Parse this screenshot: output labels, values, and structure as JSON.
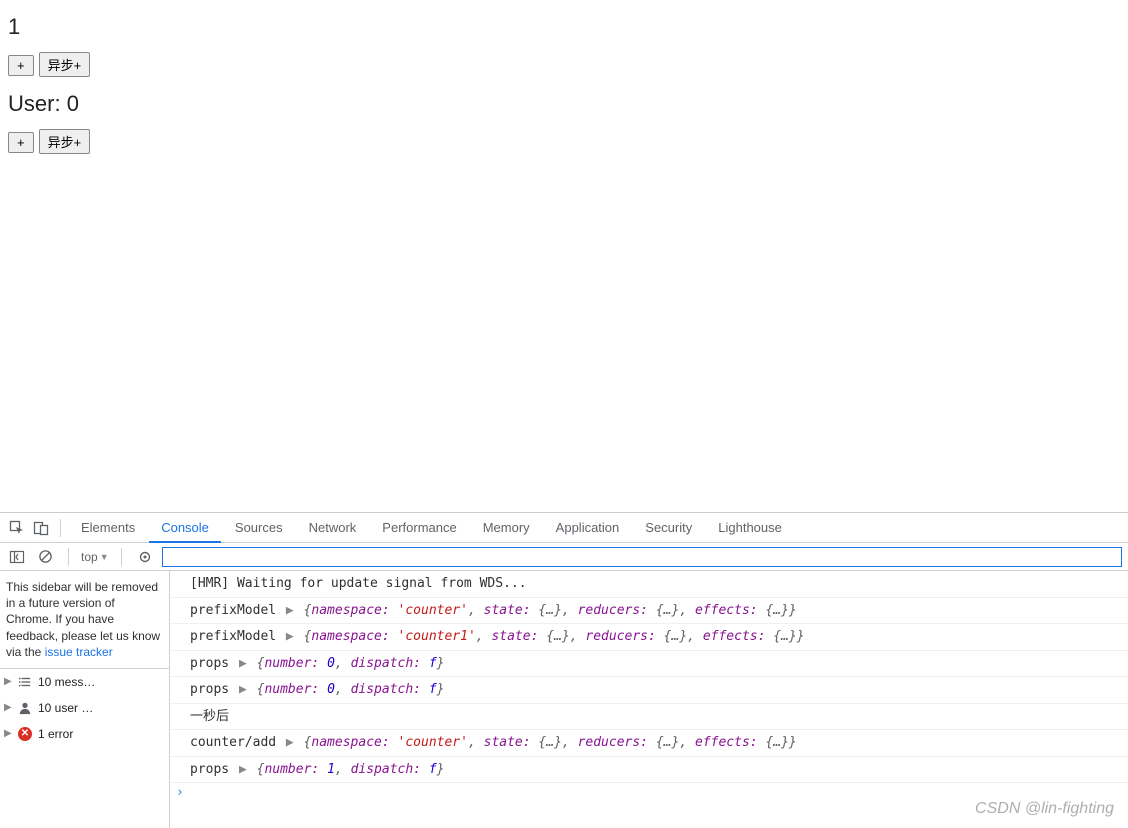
{
  "app": {
    "counter_value": "1",
    "plus_label": "+",
    "async_label": "异步+",
    "user_label_prefix": "User: ",
    "user_value": "0"
  },
  "devtools": {
    "tabs": [
      "Elements",
      "Console",
      "Sources",
      "Network",
      "Performance",
      "Memory",
      "Application",
      "Security",
      "Lighthouse"
    ],
    "active_tab": "Console",
    "context_label": "top",
    "filter_placeholder": "",
    "sidebar_notice_1": "This sidebar will be removed in a future version of Chrome. If you have feedback, please let us know via the ",
    "sidebar_notice_link": "issue tracker",
    "stats": [
      {
        "icon": "list",
        "label": "10 mess…"
      },
      {
        "icon": "user",
        "label": "10 user …"
      },
      {
        "icon": "error",
        "label": "1 error"
      }
    ]
  },
  "console_lines": [
    {
      "type": "plain",
      "text": "[HMR] Waiting for update signal from WDS..."
    },
    {
      "type": "obj",
      "label": "prefixModel",
      "segments": [
        {
          "k": "namespace:",
          "v": "'counter'",
          "cls": "str"
        },
        {
          "k": "state:",
          "v": "{…}",
          "cls": "obj"
        },
        {
          "k": "reducers:",
          "v": "{…}",
          "cls": "obj"
        },
        {
          "k": "effects:",
          "v": "{…}",
          "cls": "obj"
        }
      ]
    },
    {
      "type": "obj",
      "label": "prefixModel",
      "segments": [
        {
          "k": "namespace:",
          "v": "'counter1'",
          "cls": "str"
        },
        {
          "k": "state:",
          "v": "{…}",
          "cls": "obj"
        },
        {
          "k": "reducers:",
          "v": "{…}",
          "cls": "obj"
        },
        {
          "k": "effects:",
          "v": "{…}",
          "cls": "obj"
        }
      ]
    },
    {
      "type": "obj",
      "label": "props",
      "segments": [
        {
          "k": "number:",
          "v": "0",
          "cls": "num"
        },
        {
          "k": "dispatch:",
          "v": "f",
          "cls": "fn"
        }
      ]
    },
    {
      "type": "obj",
      "label": "props",
      "segments": [
        {
          "k": "number:",
          "v": "0",
          "cls": "num"
        },
        {
          "k": "dispatch:",
          "v": "f",
          "cls": "fn"
        }
      ]
    },
    {
      "type": "plain",
      "text": "一秒后"
    },
    {
      "type": "obj",
      "label": "counter/add",
      "segments": [
        {
          "k": "namespace:",
          "v": "'counter'",
          "cls": "str"
        },
        {
          "k": "state:",
          "v": "{…}",
          "cls": "obj"
        },
        {
          "k": "reducers:",
          "v": "{…}",
          "cls": "obj"
        },
        {
          "k": "effects:",
          "v": "{…}",
          "cls": "obj"
        }
      ]
    },
    {
      "type": "obj",
      "label": "props",
      "segments": [
        {
          "k": "number:",
          "v": "1",
          "cls": "num"
        },
        {
          "k": "dispatch:",
          "v": "f",
          "cls": "fn"
        }
      ]
    }
  ],
  "watermark": "CSDN @lin-fighting"
}
